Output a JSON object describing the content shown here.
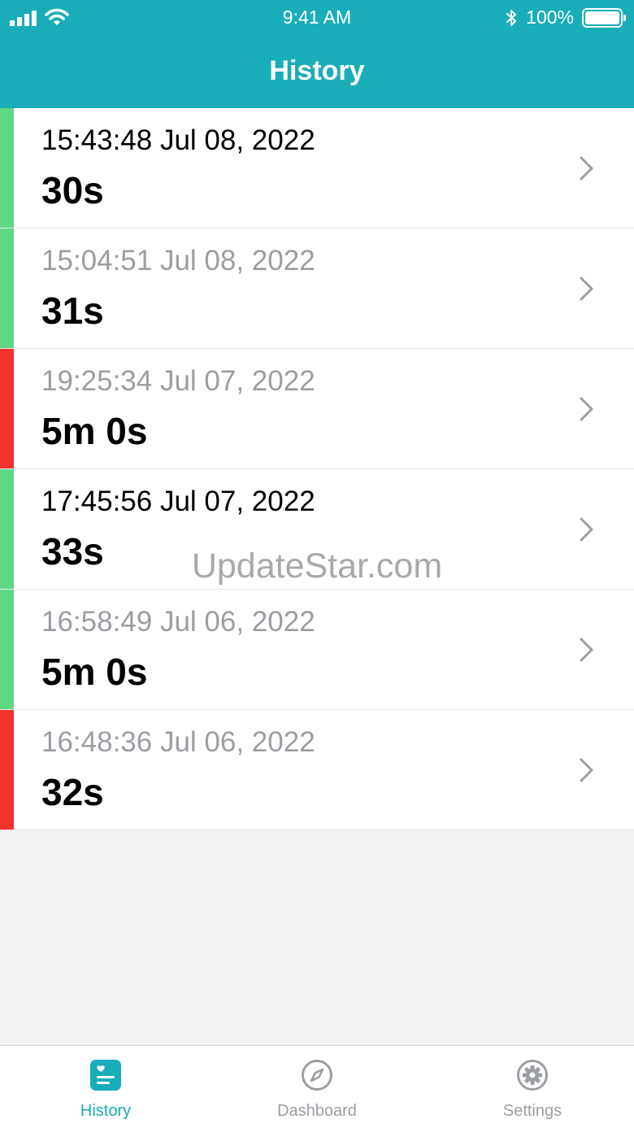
{
  "colors": {
    "header": "#19adba",
    "accent": "#19adba",
    "ok": "#5ed884",
    "alert": "#f2322c",
    "inactive": "#9a9ea3",
    "ts_active": "#000000",
    "ts_muted": "#9a9ea3"
  },
  "status_bar": {
    "time": "9:41 AM",
    "battery": "100%",
    "icons": [
      "signal-icon",
      "wifi-icon",
      "bluetooth-icon",
      "battery-icon"
    ]
  },
  "header": {
    "title": "History"
  },
  "records": [
    {
      "timestamp": "15:43:48 Jul 08, 2022",
      "duration": "30s",
      "status": "ok",
      "timestamp_style": "active"
    },
    {
      "timestamp": "15:04:51 Jul 08, 2022",
      "duration": "31s",
      "status": "ok",
      "timestamp_style": "muted"
    },
    {
      "timestamp": "19:25:34 Jul 07, 2022",
      "duration": "5m 0s",
      "status": "alert",
      "timestamp_style": "muted"
    },
    {
      "timestamp": "17:45:56 Jul 07, 2022",
      "duration": "33s",
      "status": "ok",
      "timestamp_style": "active"
    },
    {
      "timestamp": "16:58:49 Jul 06, 2022",
      "duration": "5m 0s",
      "status": "ok",
      "timestamp_style": "muted"
    },
    {
      "timestamp": "16:48:36 Jul 06, 2022",
      "duration": "32s",
      "status": "alert",
      "timestamp_style": "muted"
    }
  ],
  "watermark": "UpdateStar.com",
  "tabbar": {
    "tabs": [
      {
        "label": "History",
        "icon": "heart-list-icon",
        "active": true
      },
      {
        "label": "Dashboard",
        "icon": "compass-icon",
        "active": false
      },
      {
        "label": "Settings",
        "icon": "gear-icon",
        "active": false
      }
    ]
  }
}
